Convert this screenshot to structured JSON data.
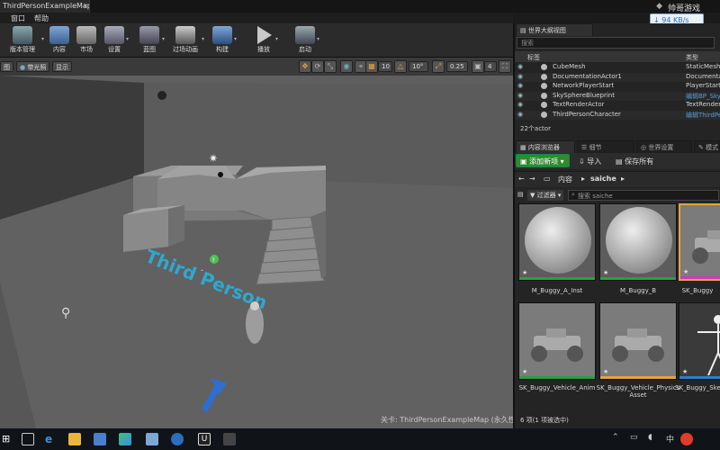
{
  "window": {
    "title": "ThirdPersonExampleMap*",
    "close": "✕",
    "brand": "帅哥游戏",
    "net_speed": "↓ 94 KB/s"
  },
  "menu": [
    "窗口",
    "帮助"
  ],
  "toolbar": {
    "buttons": [
      {
        "label": "版本管理"
      },
      {
        "label": "内容"
      },
      {
        "label": "市场"
      },
      {
        "label": "设置"
      },
      {
        "label": "蓝图"
      },
      {
        "label": "过场动画"
      },
      {
        "label": "构建"
      },
      {
        "label": "播放"
      },
      {
        "label": "启动"
      }
    ]
  },
  "viewport_bar": {
    "left_buttons": [
      "图",
      "带光照",
      "显示"
    ],
    "grid_snap": "10",
    "rot_snap": "10°",
    "scale_snap": "0.25",
    "cam_speed": "4"
  },
  "viewport": {
    "floor_text": "Third Person",
    "caption": "关卡: ThirdPersonExampleMap (永久性)"
  },
  "outliner": {
    "tab": "世界大纲视图",
    "search_placeholder": "搜索",
    "col_label": "标签",
    "col_type": "类型",
    "rows": [
      {
        "name": "CubeMesh",
        "type": "StaticMeshActor",
        "link": false
      },
      {
        "name": "DocumentationActor1",
        "type": "DocumentationActor",
        "link": false
      },
      {
        "name": "NetworkPlayerStart",
        "type": "PlayerStart",
        "link": false
      },
      {
        "name": "SkySphereBlueprint",
        "type": "编辑BP_Sky_Sphere",
        "link": true
      },
      {
        "name": "TextRenderActor",
        "type": "TextRenderActor",
        "link": false
      },
      {
        "name": "ThirdPersonCharacter",
        "type": "编辑ThirdPersonCharacter",
        "link": true
      }
    ],
    "count": "22个actor"
  },
  "content_browser": {
    "tabs": [
      "内容浏览器",
      "细节",
      "世界设置",
      "模式"
    ],
    "add_new": "添加新项",
    "import": "导入",
    "save_all": "保存所有",
    "path": [
      "内容",
      "saiche"
    ],
    "filter": "过滤器",
    "search_placeholder": "搜索 saiche",
    "assets": [
      {
        "name": "M_Buggy_A_Inst",
        "kind": "sphere",
        "stripe": "#2e9e3e"
      },
      {
        "name": "M_Buggy_B",
        "kind": "sphere",
        "stripe": "#2e9e3e"
      },
      {
        "name": "SK_Buggy",
        "kind": "buggy",
        "stripe": "#c53fb8"
      },
      {
        "name": "SK_Buggy_Vehicle_Anim",
        "kind": "buggy",
        "stripe": "#2e9e3e"
      },
      {
        "name": "SK_Buggy_Vehicle_Physics Asset",
        "kind": "buggy",
        "stripe": "#e8a33c"
      },
      {
        "name": "SK_Buggy_Skeleton",
        "kind": "skeleton",
        "stripe": "#2d7fd0"
      }
    ],
    "status": "6 项(1 项被选中)"
  }
}
